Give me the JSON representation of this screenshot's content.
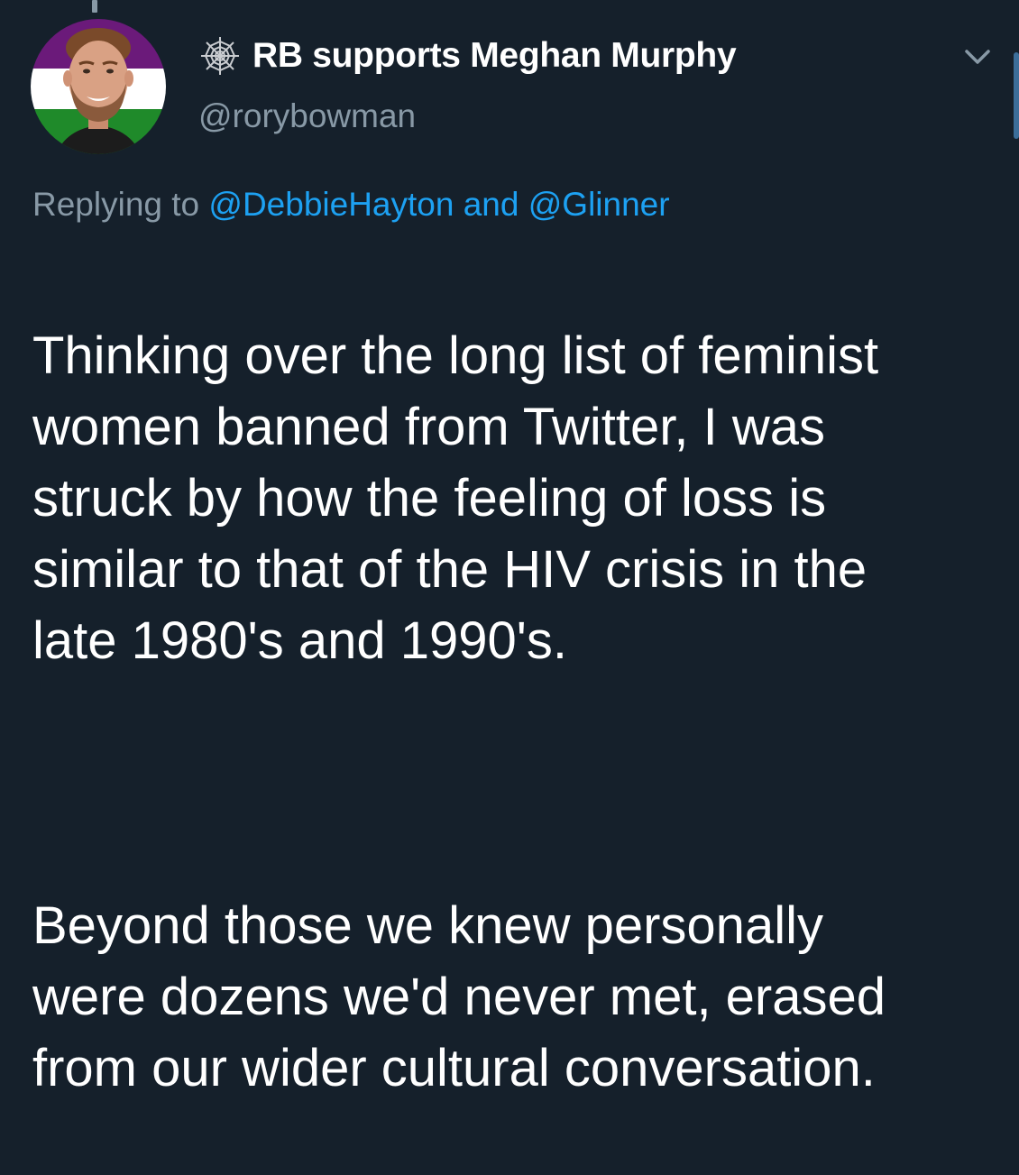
{
  "tweet": {
    "display_name": "RB supports Meghan Murphy",
    "handle": "@rorybowman",
    "name_icon": "spider-web-icon",
    "menu_icon": "chevron-down-icon",
    "replying_to_prefix": "Replying to",
    "replying_to_user1": "@DebbieHayton",
    "replying_to_joiner": "and",
    "replying_to_user2": "@Glinner",
    "paragraph1": "Thinking over the long list of feminist\nwomen banned from Twitter, I was\nstruck by how the feeling of loss is\nsimilar to that of the HIV crisis in the\nlate 1980's and 1990's.",
    "paragraph2": "Beyond those we knew personally\nwere dozens we'd never met, erased\nfrom our wider cultural conversation."
  },
  "colors": {
    "background": "#15202b",
    "text_primary": "#ffffff",
    "text_secondary": "#8899a6",
    "link": "#1da1f2",
    "avatar_ring_top": "#6b1a7a",
    "avatar_ring_middle": "#ffffff",
    "avatar_ring_bottom": "#1f8a2a"
  }
}
